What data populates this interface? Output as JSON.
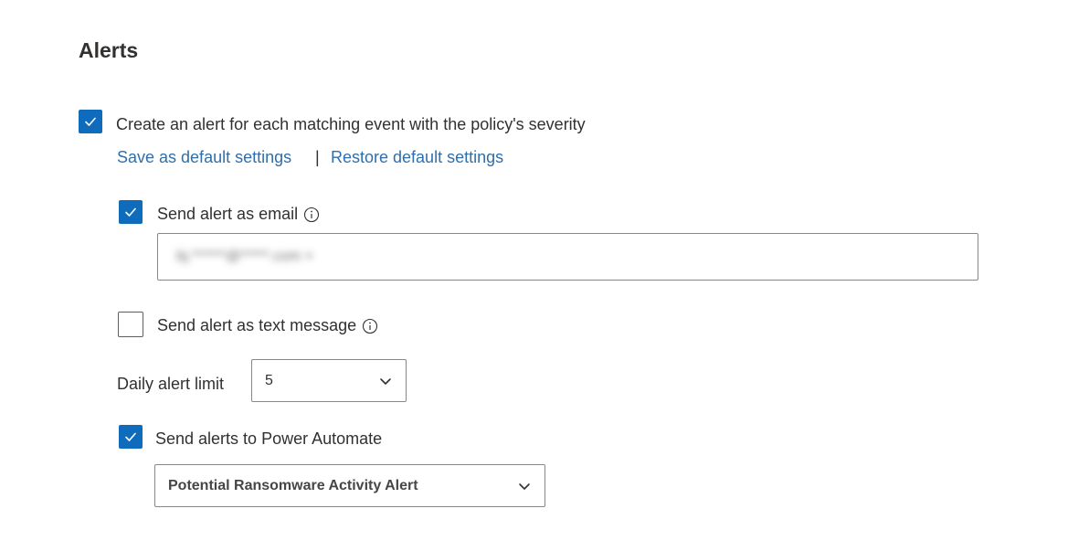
{
  "section": {
    "title": "Alerts"
  },
  "create_alert": {
    "checked": true,
    "label": "Create an alert for each matching event with the policy's severity"
  },
  "links": {
    "save_default": "Save as default settings",
    "separator": "|",
    "restore_default": "Restore default settings"
  },
  "email_alert": {
    "checked": true,
    "label": "Send alert as email",
    "info_icon": "info-icon",
    "value": "bj.******@*****.com ×"
  },
  "text_alert": {
    "checked": false,
    "label": "Send alert as text message",
    "info_icon": "info-icon"
  },
  "daily_limit": {
    "label": "Daily alert limit",
    "selected": "5"
  },
  "power_automate": {
    "checked": true,
    "label": "Send alerts to Power Automate",
    "selected": "Potential Ransomware Activity Alert"
  },
  "colors": {
    "accent": "#0f6cbd",
    "link": "#2f6fab",
    "text": "#323130",
    "border": "#8a8886"
  }
}
